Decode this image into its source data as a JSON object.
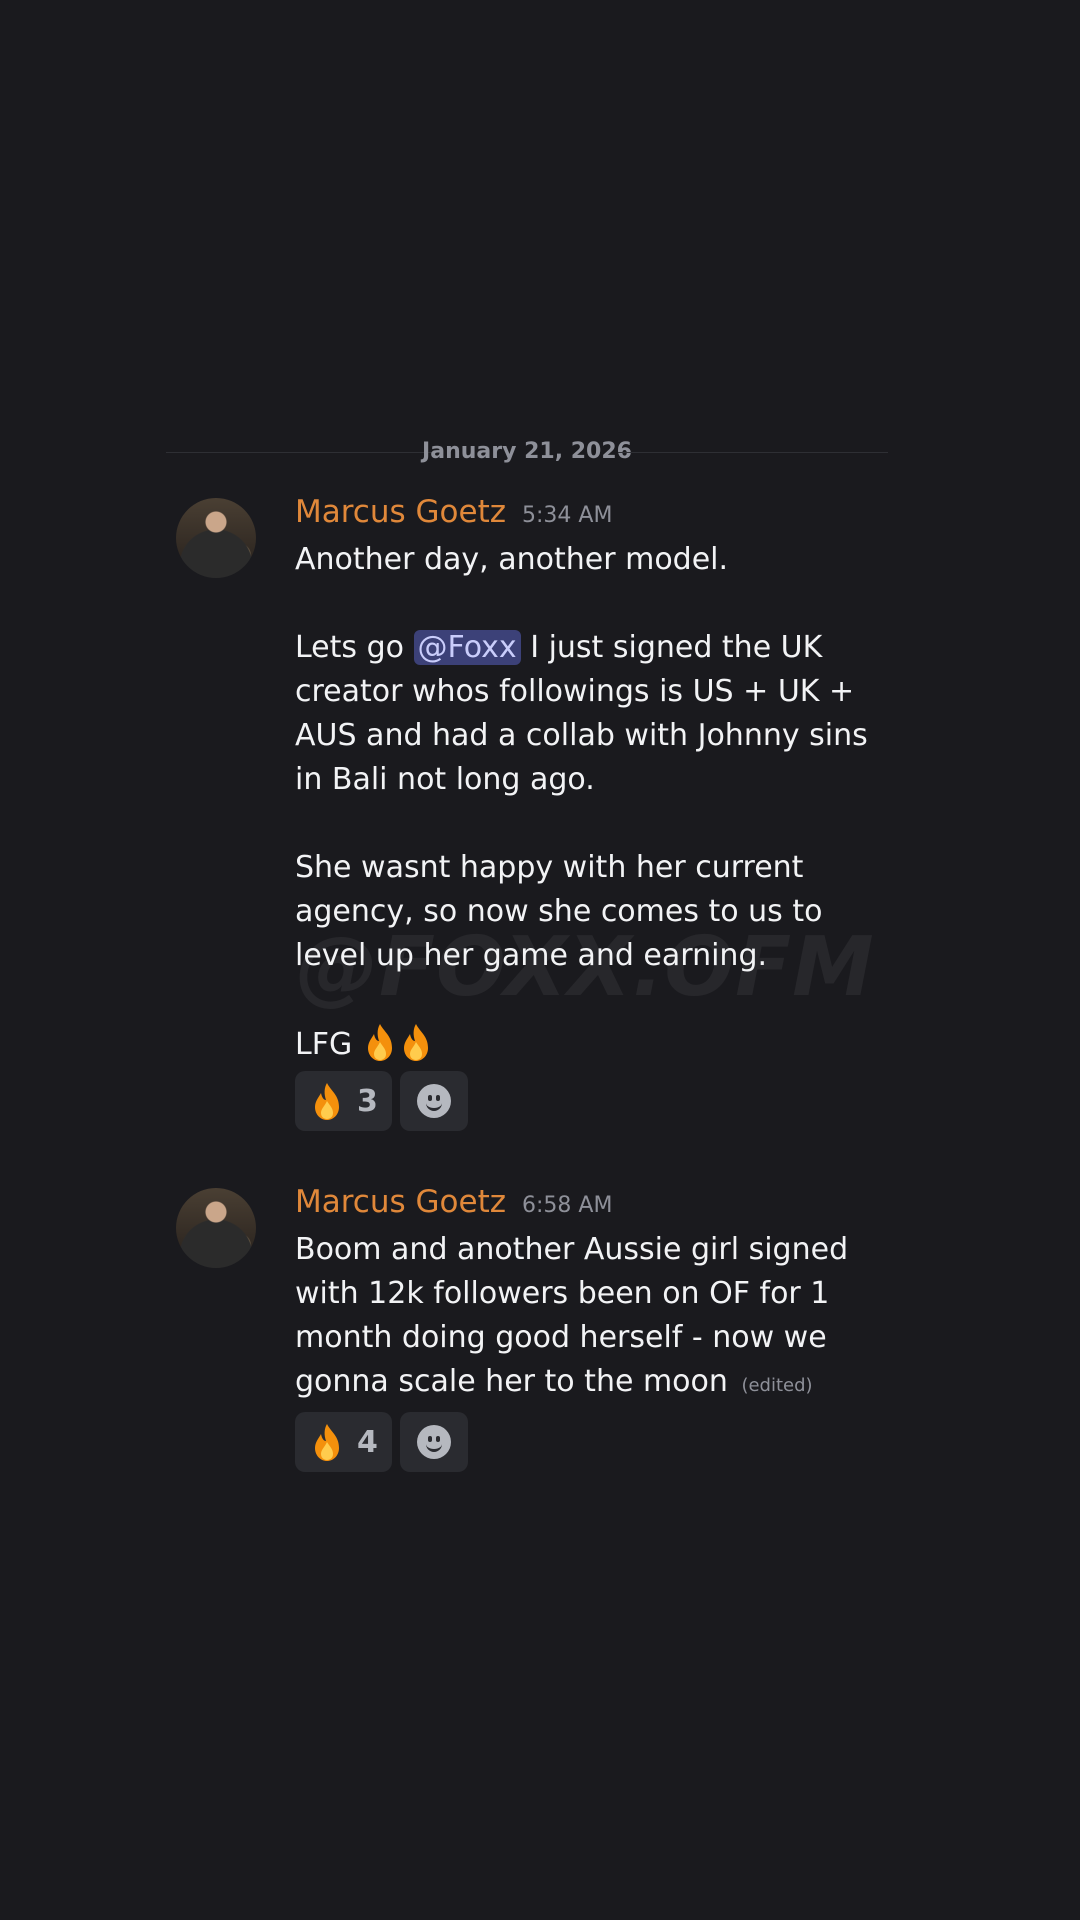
{
  "date_divider": "January 21, 2026",
  "watermark": "@FOXX.OFM",
  "messages": [
    {
      "username": "Marcus Goetz",
      "timestamp": "5:34 AM",
      "line1": "Another day, another model.",
      "p2_before": "Lets go ",
      "mention": "@Foxx",
      "p2_after": " I just signed the UK creator whos followings is US + UK + AUS and had a collab with Johnny sins in Bali not long ago.",
      "p3": "She wasnt happy with her current agency, so now she comes to us to level up her game and earning.",
      "p4": "LFG",
      "reactions": [
        {
          "emoji": "fire-icon",
          "count": "3"
        }
      ]
    },
    {
      "username": "Marcus Goetz",
      "timestamp": "6:58 AM",
      "text": "Boom and another Aussie girl signed with 12k followers been on OF for 1 month doing good herself - now we gonna scale her to the moon",
      "edited": "(edited)",
      "reactions": [
        {
          "emoji": "fire-icon",
          "count": "4"
        }
      ]
    }
  ],
  "colors": {
    "background": "#1a1a1e",
    "username": "#e0883a",
    "mention_bg": "#3c4178",
    "reaction_bg": "#2a2b30"
  }
}
